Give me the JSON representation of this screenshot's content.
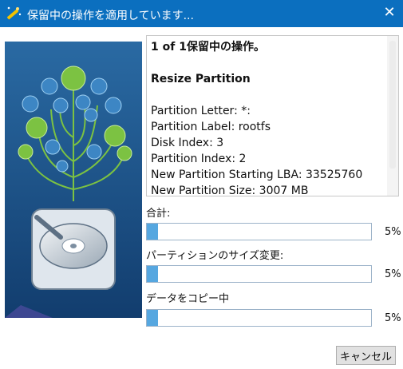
{
  "window": {
    "title": "保留中の操作を適用しています..."
  },
  "operation": {
    "header": "1 of 1保留中の操作。",
    "name": "Resize Partition",
    "details": [
      "Partition Letter: *:",
      "Partition Label: rootfs",
      "Disk Index: 3",
      "Partition Index: 2",
      "New Partition Starting LBA: 33525760",
      "New Partition Size: 3007 MB"
    ]
  },
  "progress": [
    {
      "label": "合計:",
      "value_percent": 5,
      "percent_text": "5%"
    },
    {
      "label": "パーティションのサイズ変更:",
      "value_percent": 5,
      "percent_text": "5%"
    },
    {
      "label": "データをコピー中",
      "value_percent": 5,
      "percent_text": "5%"
    }
  ],
  "buttons": {
    "cancel": "キャンセル"
  },
  "colors": {
    "titlebar": "#0b6fbf",
    "progress_fill": "#56a7e0",
    "illustration_bg": "#1a4f86",
    "illustration_accent": "#7cc242"
  },
  "icons": {
    "app": "wand-icon",
    "close": "close-icon",
    "illustration": "disk-tree-illustration"
  }
}
